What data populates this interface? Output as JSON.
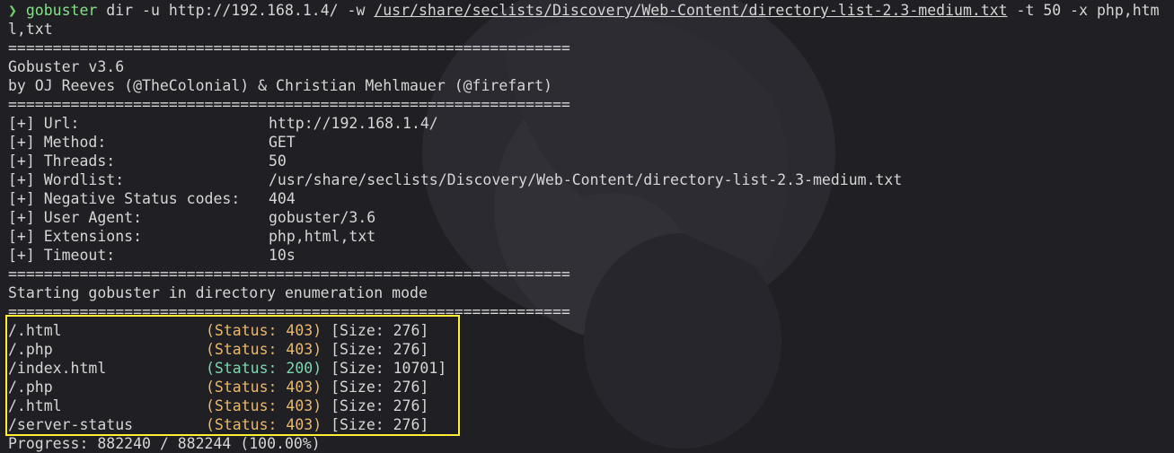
{
  "command": {
    "prompt_symbol": "❯",
    "program": "gobuster",
    "args_before_path": " dir -u http://192.168.1.4/ -w ",
    "wordlist_path": "/usr/share/seclists/Discovery/Web-Content/directory-list-2.3-medium.txt",
    "args_after_path": " -t 50 -x php,htm",
    "wrap": "l,txt"
  },
  "separator": "===============================================================",
  "banner": {
    "version": "Gobuster v3.6",
    "authors": "by OJ Reeves (@TheColonial) & Christian Mehlmauer (@firefart)"
  },
  "config": [
    {
      "key": "[+] Url:",
      "value": "http://192.168.1.4/"
    },
    {
      "key": "[+] Method:",
      "value": "GET"
    },
    {
      "key": "[+] Threads:",
      "value": "50"
    },
    {
      "key": "[+] Wordlist:",
      "value": "/usr/share/seclists/Discovery/Web-Content/directory-list-2.3-medium.txt"
    },
    {
      "key": "[+] Negative Status codes:",
      "value": "404"
    },
    {
      "key": "[+] User Agent:",
      "value": "gobuster/3.6"
    },
    {
      "key": "[+] Extensions:",
      "value": "php,html,txt"
    },
    {
      "key": "[+] Timeout:",
      "value": "10s"
    }
  ],
  "start_message": "Starting gobuster in directory enumeration mode",
  "results": [
    {
      "path": "/.html",
      "status": "(Status: 403)",
      "size": "[Size: 276]"
    },
    {
      "path": "/.php",
      "status": "(Status: 403)",
      "size": "[Size: 276]"
    },
    {
      "path": "/index.html",
      "status": "(Status: 200)",
      "size": "[Size: 10701]"
    },
    {
      "path": "/.php",
      "status": "(Status: 403)",
      "size": "[Size: 276]"
    },
    {
      "path": "/.html",
      "status": "(Status: 403)",
      "size": "[Size: 276]"
    },
    {
      "path": "/server-status",
      "status": "(Status: 403)",
      "size": "[Size: 276]"
    }
  ],
  "progress": "Progress: 882240 / 882244 (100.00%)",
  "colors": {
    "status_403": "#e9b96e",
    "status_200": "#7fd6b0",
    "highlight_box": "#ffee33",
    "background": "#1f1f24"
  }
}
